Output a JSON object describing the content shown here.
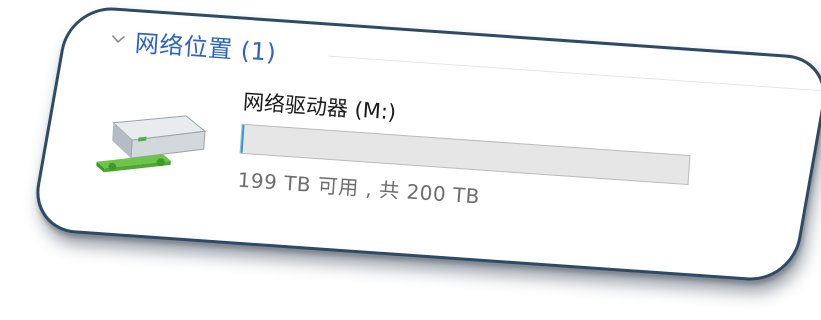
{
  "group": {
    "title": "网络位置 (1)"
  },
  "drive": {
    "name": "网络驱动器 (M:)",
    "size_text": "199 TB 可用 , 共 200 TB",
    "used_fraction": 0.005
  },
  "colors": {
    "accent": "#2c63c4",
    "card_border": "#2d4a66"
  },
  "icons": {
    "chevron": "chevron-down-icon",
    "drive": "network-drive-icon"
  }
}
